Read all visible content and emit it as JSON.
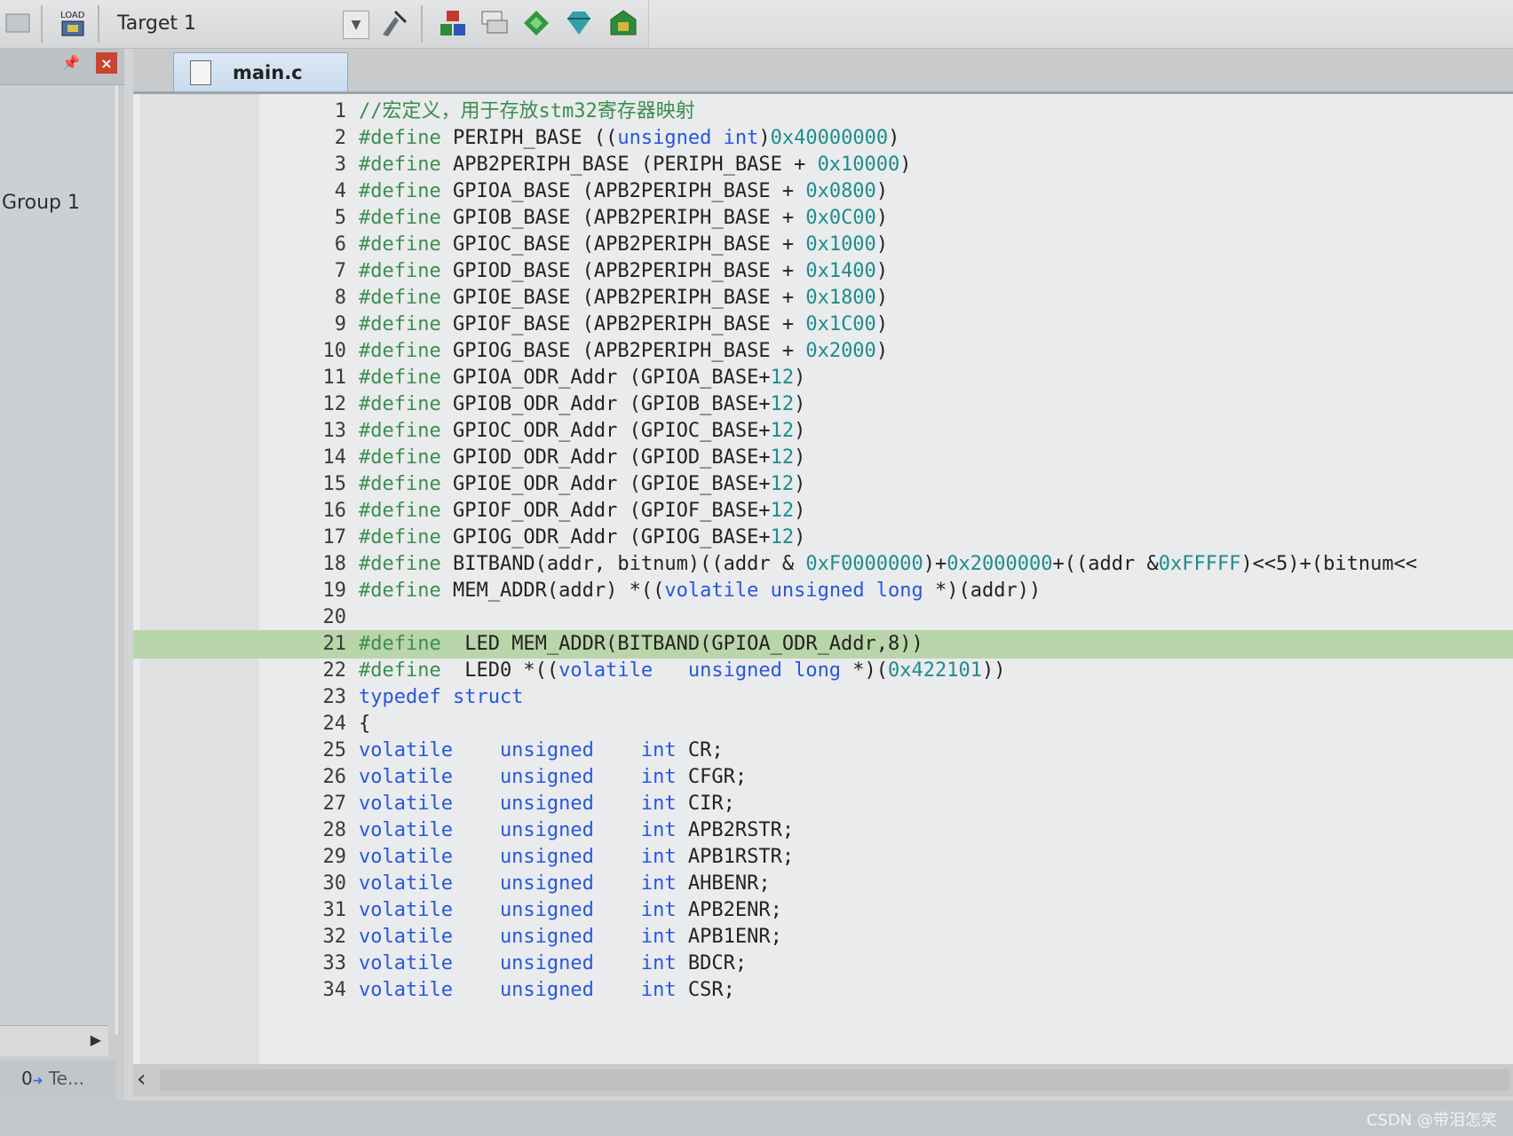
{
  "toolbar": {
    "load_label": "LOAD",
    "target": "Target 1"
  },
  "project_panel": {
    "group": "Group 1",
    "tab": "Te..."
  },
  "editor": {
    "tab": "main.c",
    "lines": [
      {
        "n": "1",
        "code": [
          {
            "c": "cm",
            "t": "//宏定义，用于存放stm32寄存器映射"
          }
        ]
      },
      {
        "n": "2",
        "code": [
          {
            "c": "pp",
            "t": "#define"
          },
          {
            "t": " PERIPH_BASE (("
          },
          {
            "c": "kw",
            "t": "unsigned int"
          },
          {
            "t": ")"
          },
          {
            "c": "nm",
            "t": "0x40000000"
          },
          {
            "t": ")"
          }
        ]
      },
      {
        "n": "3",
        "code": [
          {
            "c": "pp",
            "t": "#define"
          },
          {
            "t": " APB2PERIPH_BASE (PERIPH_BASE + "
          },
          {
            "c": "nm",
            "t": "0x10000"
          },
          {
            "t": ")"
          }
        ]
      },
      {
        "n": "4",
        "code": [
          {
            "c": "pp",
            "t": "#define"
          },
          {
            "t": " GPIOA_BASE (APB2PERIPH_BASE + "
          },
          {
            "c": "nm",
            "t": "0x0800"
          },
          {
            "t": ")"
          }
        ]
      },
      {
        "n": "5",
        "code": [
          {
            "c": "pp",
            "t": "#define"
          },
          {
            "t": " GPIOB_BASE (APB2PERIPH_BASE + "
          },
          {
            "c": "nm",
            "t": "0x0C00"
          },
          {
            "t": ")"
          }
        ]
      },
      {
        "n": "6",
        "code": [
          {
            "c": "pp",
            "t": "#define"
          },
          {
            "t": " GPIOC_BASE (APB2PERIPH_BASE + "
          },
          {
            "c": "nm",
            "t": "0x1000"
          },
          {
            "t": ")"
          }
        ]
      },
      {
        "n": "7",
        "code": [
          {
            "c": "pp",
            "t": "#define"
          },
          {
            "t": " GPIOD_BASE (APB2PERIPH_BASE + "
          },
          {
            "c": "nm",
            "t": "0x1400"
          },
          {
            "t": ")"
          }
        ]
      },
      {
        "n": "8",
        "code": [
          {
            "c": "pp",
            "t": "#define"
          },
          {
            "t": " GPIOE_BASE (APB2PERIPH_BASE + "
          },
          {
            "c": "nm",
            "t": "0x1800"
          },
          {
            "t": ")"
          }
        ]
      },
      {
        "n": "9",
        "code": [
          {
            "c": "pp",
            "t": "#define"
          },
          {
            "t": " GPIOF_BASE (APB2PERIPH_BASE + "
          },
          {
            "c": "nm",
            "t": "0x1C00"
          },
          {
            "t": ")"
          }
        ]
      },
      {
        "n": "10",
        "code": [
          {
            "c": "pp",
            "t": "#define"
          },
          {
            "t": " GPIOG_BASE (APB2PERIPH_BASE + "
          },
          {
            "c": "nm",
            "t": "0x2000"
          },
          {
            "t": ")"
          }
        ]
      },
      {
        "n": "11",
        "code": [
          {
            "c": "pp",
            "t": "#define"
          },
          {
            "t": " GPIOA_ODR_Addr (GPIOA_BASE+"
          },
          {
            "c": "nm",
            "t": "12"
          },
          {
            "t": ")"
          }
        ]
      },
      {
        "n": "12",
        "code": [
          {
            "c": "pp",
            "t": "#define"
          },
          {
            "t": " GPIOB_ODR_Addr (GPIOB_BASE+"
          },
          {
            "c": "nm",
            "t": "12"
          },
          {
            "t": ")"
          }
        ]
      },
      {
        "n": "13",
        "code": [
          {
            "c": "pp",
            "t": "#define"
          },
          {
            "t": " GPIOC_ODR_Addr (GPIOC_BASE+"
          },
          {
            "c": "nm",
            "t": "12"
          },
          {
            "t": ")"
          }
        ]
      },
      {
        "n": "14",
        "code": [
          {
            "c": "pp",
            "t": "#define"
          },
          {
            "t": " GPIOD_ODR_Addr (GPIOD_BASE+"
          },
          {
            "c": "nm",
            "t": "12"
          },
          {
            "t": ")"
          }
        ]
      },
      {
        "n": "15",
        "code": [
          {
            "c": "pp",
            "t": "#define"
          },
          {
            "t": " GPIOE_ODR_Addr (GPIOE_BASE+"
          },
          {
            "c": "nm",
            "t": "12"
          },
          {
            "t": ")"
          }
        ]
      },
      {
        "n": "16",
        "code": [
          {
            "c": "pp",
            "t": "#define"
          },
          {
            "t": " GPIOF_ODR_Addr (GPIOF_BASE+"
          },
          {
            "c": "nm",
            "t": "12"
          },
          {
            "t": ")"
          }
        ]
      },
      {
        "n": "17",
        "code": [
          {
            "c": "pp",
            "t": "#define"
          },
          {
            "t": " GPIOG_ODR_Addr (GPIOG_BASE+"
          },
          {
            "c": "nm",
            "t": "12"
          },
          {
            "t": ")"
          }
        ]
      },
      {
        "n": "18",
        "code": [
          {
            "c": "pp",
            "t": "#define"
          },
          {
            "t": " BITBAND(addr, bitnum)((addr & "
          },
          {
            "c": "nm",
            "t": "0xF0000000"
          },
          {
            "t": ")+"
          },
          {
            "c": "nm",
            "t": "0x2000000"
          },
          {
            "t": "+((addr &"
          },
          {
            "c": "nm",
            "t": "0xFFFFF"
          },
          {
            "t": ")<<5)+(bitnum<<"
          }
        ]
      },
      {
        "n": "19",
        "code": [
          {
            "c": "pp",
            "t": "#define"
          },
          {
            "t": " MEM_ADDR(addr) *(("
          },
          {
            "c": "kw",
            "t": "volatile unsigned long"
          },
          {
            "t": " *)(addr))"
          }
        ]
      },
      {
        "n": "20",
        "code": []
      },
      {
        "n": "21",
        "current": true,
        "code": [
          {
            "c": "pp",
            "t": "#define"
          },
          {
            "t": "  LED MEM_ADDR(BITBAND(GPIOA_ODR_Addr,8))"
          }
        ]
      },
      {
        "n": "22",
        "code": [
          {
            "c": "pp",
            "t": "#define"
          },
          {
            "t": "  LED0 *(("
          },
          {
            "c": "kw",
            "t": "volatile   unsigned long"
          },
          {
            "t": " *)("
          },
          {
            "c": "nm",
            "t": "0x422101"
          },
          {
            "t": "))"
          }
        ]
      },
      {
        "n": "23",
        "code": [
          {
            "c": "kw",
            "t": "typedef struct"
          }
        ]
      },
      {
        "n": "24",
        "code": [
          {
            "t": "{"
          }
        ]
      },
      {
        "n": "25",
        "code": [
          {
            "c": "kw",
            "t": "volatile    unsigned    int"
          },
          {
            "t": " CR;"
          }
        ]
      },
      {
        "n": "26",
        "code": [
          {
            "c": "kw",
            "t": "volatile    unsigned    int"
          },
          {
            "t": " CFGR;"
          }
        ]
      },
      {
        "n": "27",
        "code": [
          {
            "c": "kw",
            "t": "volatile    unsigned    int"
          },
          {
            "t": " CIR;"
          }
        ]
      },
      {
        "n": "28",
        "code": [
          {
            "c": "kw",
            "t": "volatile    unsigned    int"
          },
          {
            "t": " APB2RSTR;"
          }
        ]
      },
      {
        "n": "29",
        "code": [
          {
            "c": "kw",
            "t": "volatile    unsigned    int"
          },
          {
            "t": " APB1RSTR;"
          }
        ]
      },
      {
        "n": "30",
        "code": [
          {
            "c": "kw",
            "t": "volatile    unsigned    int"
          },
          {
            "t": " AHBENR;"
          }
        ]
      },
      {
        "n": "31",
        "code": [
          {
            "c": "kw",
            "t": "volatile    unsigned    int"
          },
          {
            "t": " APB2ENR;"
          }
        ]
      },
      {
        "n": "32",
        "code": [
          {
            "c": "kw",
            "t": "volatile    unsigned    int"
          },
          {
            "t": " APB1ENR;"
          }
        ]
      },
      {
        "n": "33",
        "code": [
          {
            "c": "kw",
            "t": "volatile    unsigned    int"
          },
          {
            "t": " BDCR;"
          }
        ]
      },
      {
        "n": "34",
        "code": [
          {
            "c": "kw",
            "t": "volatile    unsigned    int"
          },
          {
            "t": " CSR;"
          }
        ]
      }
    ]
  },
  "watermark": "CSDN @带泪怎笑",
  "colors": {
    "preprocessor": "#3b8e4f",
    "keyword": "#2858d8",
    "number": "#1f8c8c",
    "current_line": "#b9d5aa"
  }
}
